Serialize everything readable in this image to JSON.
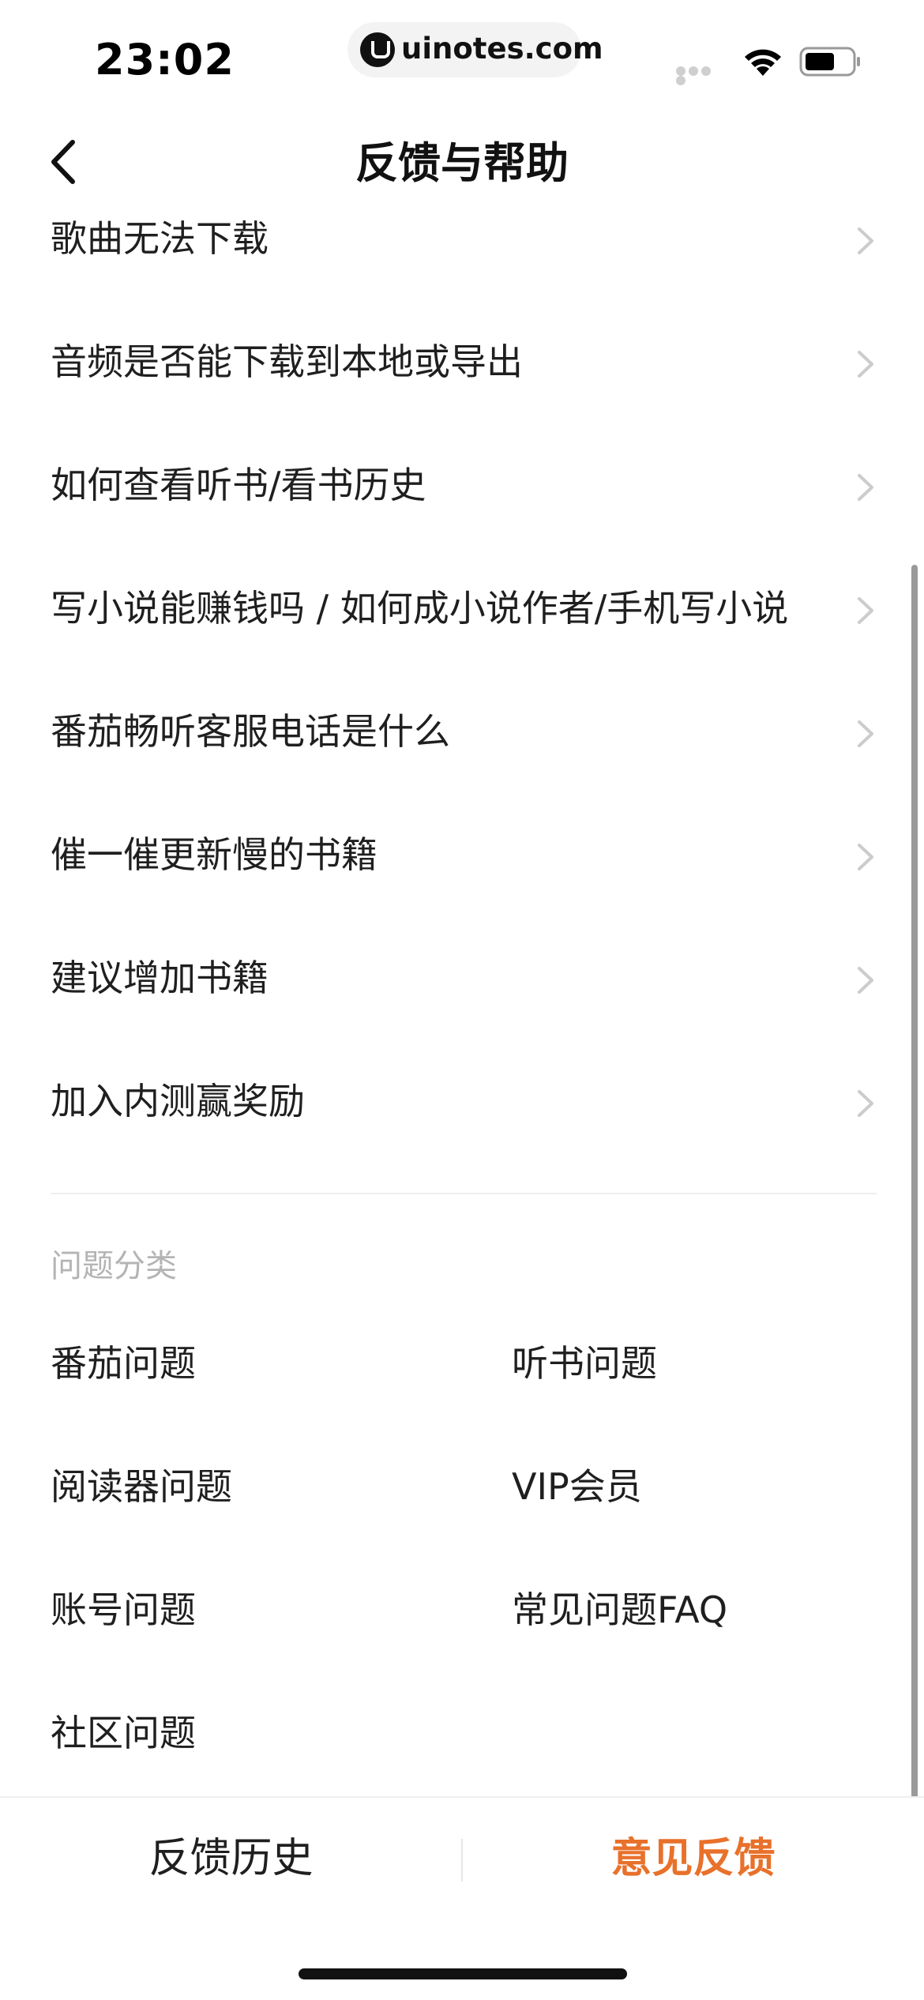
{
  "status_bar": {
    "time": "23:02",
    "url": "uinotes.com"
  },
  "nav": {
    "title": "反馈与帮助"
  },
  "faq_items": [
    {
      "label": "歌曲无法下载"
    },
    {
      "label": "音频是否能下载到本地或导出"
    },
    {
      "label": "如何查看听书/看书历史"
    },
    {
      "label": "写小说能赚钱吗 / 如何成小说作者/手机写小说"
    },
    {
      "label": "番茄畅听客服电话是什么"
    },
    {
      "label": "催一催更新慢的书籍"
    },
    {
      "label": "建议增加书籍"
    },
    {
      "label": "加入内测赢奖励"
    }
  ],
  "categories": {
    "section_label": "问题分类",
    "items": [
      {
        "label": "番茄问题"
      },
      {
        "label": "听书问题"
      },
      {
        "label": "阅读器问题"
      },
      {
        "label": "VIP会员"
      },
      {
        "label": "账号问题"
      },
      {
        "label": "常见问题FAQ"
      },
      {
        "label": "社区问题"
      }
    ]
  },
  "bottom_bar": {
    "history_label": "反馈历史",
    "feedback_label": "意见反馈"
  },
  "colors": {
    "accent": "#e8712b",
    "muted_text": "#b4b4b4",
    "chevron": "#cccccc"
  }
}
